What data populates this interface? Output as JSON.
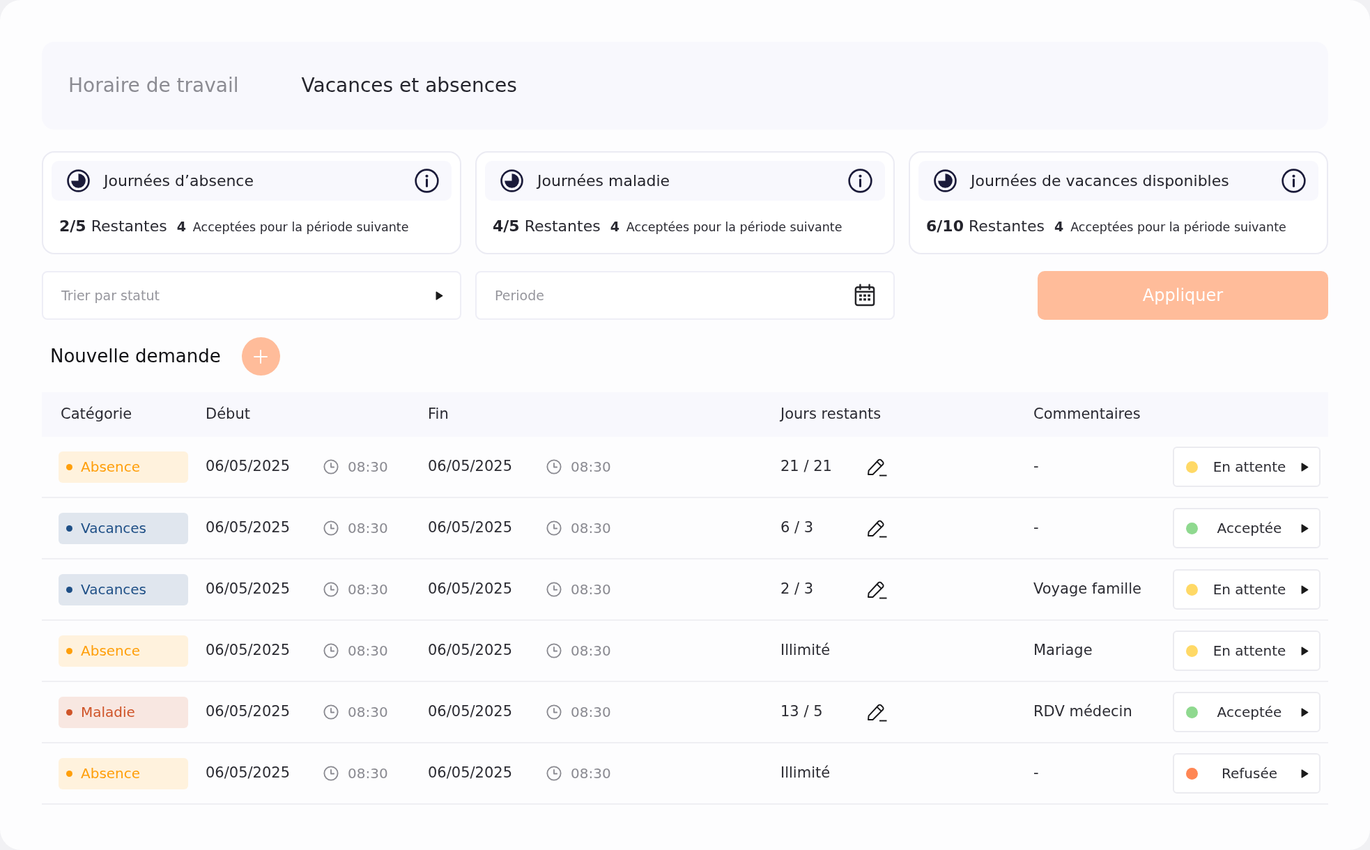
{
  "tabs": [
    {
      "label": "Horaire de travail",
      "selected": false
    },
    {
      "label": "Vacances et absences",
      "selected": true
    }
  ],
  "summary_cards": [
    {
      "title": "Journées d’absence",
      "remaining_count": "2/5",
      "remaining_label": "Restantes",
      "accepted_count": "4",
      "accepted_label": "Acceptées pour la période suivante"
    },
    {
      "title": "Journées maladie",
      "remaining_count": "4/5",
      "remaining_label": "Restantes",
      "accepted_count": "4",
      "accepted_label": "Acceptées pour la période suivante"
    },
    {
      "title": "Journées de vacances disponibles",
      "remaining_count": "6/10",
      "remaining_label": "Restantes",
      "accepted_count": "4",
      "accepted_label": "Acceptées pour la période suivante"
    }
  ],
  "filters": {
    "status_select": {
      "placeholder": "Trier par statut"
    },
    "period_field": {
      "placeholder": "Periode"
    },
    "apply_button": "Appliquer"
  },
  "new_request": {
    "label": "Nouvelle demande"
  },
  "table": {
    "columns": [
      "Catégorie",
      "Début",
      "Fin",
      "Jours restants",
      "Commentaires"
    ],
    "rows": [
      {
        "category": {
          "label": "Absence",
          "color": "#ff9f0a"
        },
        "start_date": "06/05/2025",
        "start_time": "08:30",
        "end_date": "06/05/2025",
        "end_time": "08:30",
        "days_remaining": "21 / 21",
        "editable": true,
        "comment": "-",
        "status": {
          "label": "En attente",
          "color": "#ffd966"
        }
      },
      {
        "category": {
          "label": "Vacances",
          "color": "#1e4f86"
        },
        "start_date": "06/05/2025",
        "start_time": "08:30",
        "end_date": "06/05/2025",
        "end_time": "08:30",
        "days_remaining": "6 / 3",
        "editable": true,
        "comment": "-",
        "status": {
          "label": "Acceptée",
          "color": "#8fd98f"
        }
      },
      {
        "category": {
          "label": "Vacances",
          "color": "#1e4f86"
        },
        "start_date": "06/05/2025",
        "start_time": "08:30",
        "end_date": "06/05/2025",
        "end_time": "08:30",
        "days_remaining": "2 / 3",
        "editable": true,
        "comment": "Voyage famille",
        "status": {
          "label": "En attente",
          "color": "#ffd966"
        }
      },
      {
        "category": {
          "label": "Absence",
          "color": "#ff9f0a"
        },
        "start_date": "06/05/2025",
        "start_time": "08:30",
        "end_date": "06/05/2025",
        "end_time": "08:30",
        "days_remaining": "Illimité",
        "editable": false,
        "comment": "Mariage",
        "status": {
          "label": "En attente",
          "color": "#ffd966"
        }
      },
      {
        "category": {
          "label": "Maladie",
          "color": "#cf5428"
        },
        "start_date": "06/05/2025",
        "start_time": "08:30",
        "end_date": "06/05/2025",
        "end_time": "08:30",
        "days_remaining": "13 / 5",
        "editable": true,
        "comment": "RDV médecin",
        "status": {
          "label": "Acceptée",
          "color": "#8fd98f"
        }
      },
      {
        "category": {
          "label": "Absence",
          "color": "#ff9f0a"
        },
        "start_date": "06/05/2025",
        "start_time": "08:30",
        "end_date": "06/05/2025",
        "end_time": "08:30",
        "days_remaining": "Illimité",
        "editable": false,
        "comment": "-",
        "status": {
          "label": "Refusée",
          "color": "#ff8654"
        }
      }
    ]
  }
}
